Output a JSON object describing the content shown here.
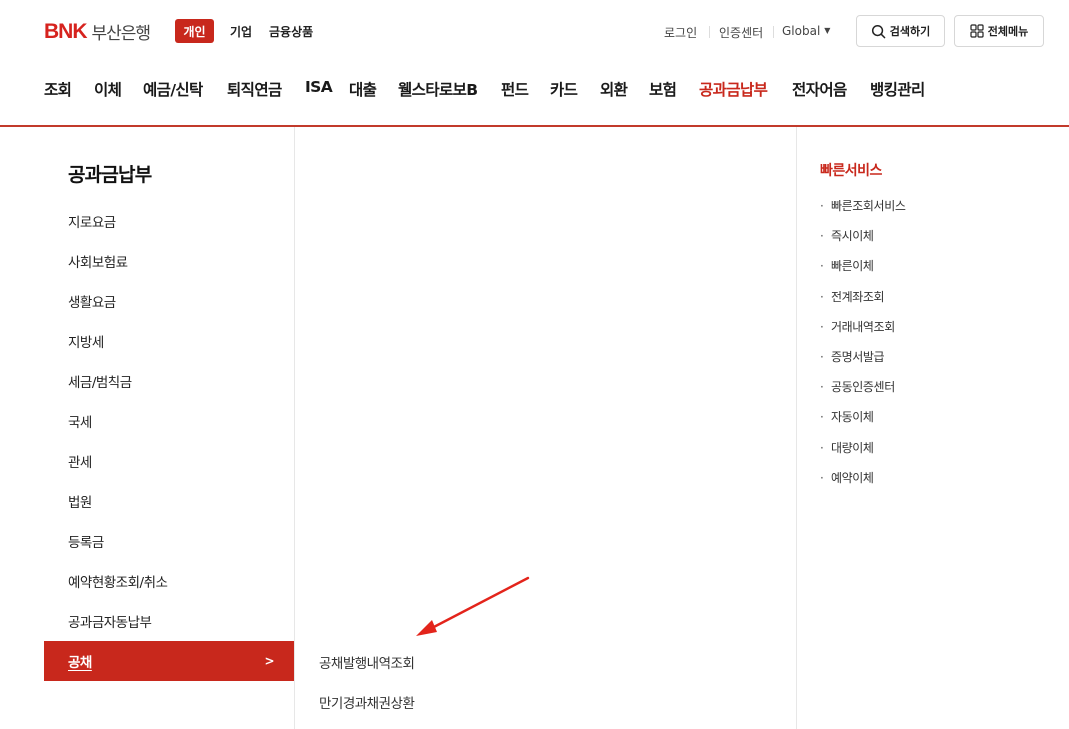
{
  "brand": {
    "logo_mark": "BNK",
    "logo_text": "부산은행",
    "accent": "#c8281c"
  },
  "segments": [
    "개인",
    "기업",
    "금융상품"
  ],
  "util": {
    "login": "로그인",
    "cert": "인증센터",
    "global": "Global",
    "search": "검색하기",
    "all_menu": "전체메뉴"
  },
  "gnb": [
    "조회",
    "이체",
    "예금/신탁",
    "퇴직연금",
    "ISA",
    "대출",
    "웰스타로보B",
    "펀드",
    "카드",
    "외환",
    "보험",
    "공과금납부",
    "전자어음",
    "뱅킹관리"
  ],
  "gnb_active_index": 11,
  "lnb": {
    "title": "공과금납부",
    "items": [
      "지로요금",
      "사회보험료",
      "생활요금",
      "지방세",
      "세금/범칙금",
      "국세",
      "관세",
      "법원",
      "등록금",
      "예약현황조회/취소",
      "공과금자동납부",
      "공채"
    ],
    "active_index": 11
  },
  "sub": [
    "공채발행내역조회",
    "만기경과채권상환"
  ],
  "quick": {
    "title": "빠른서비스",
    "items": [
      "빠른조회서비스",
      "즉시이체",
      "빠른이체",
      "전계좌조회",
      "거래내역조회",
      "증명서발급",
      "공동인증센터",
      "자동이체",
      "대량이체",
      "예약이체"
    ]
  }
}
